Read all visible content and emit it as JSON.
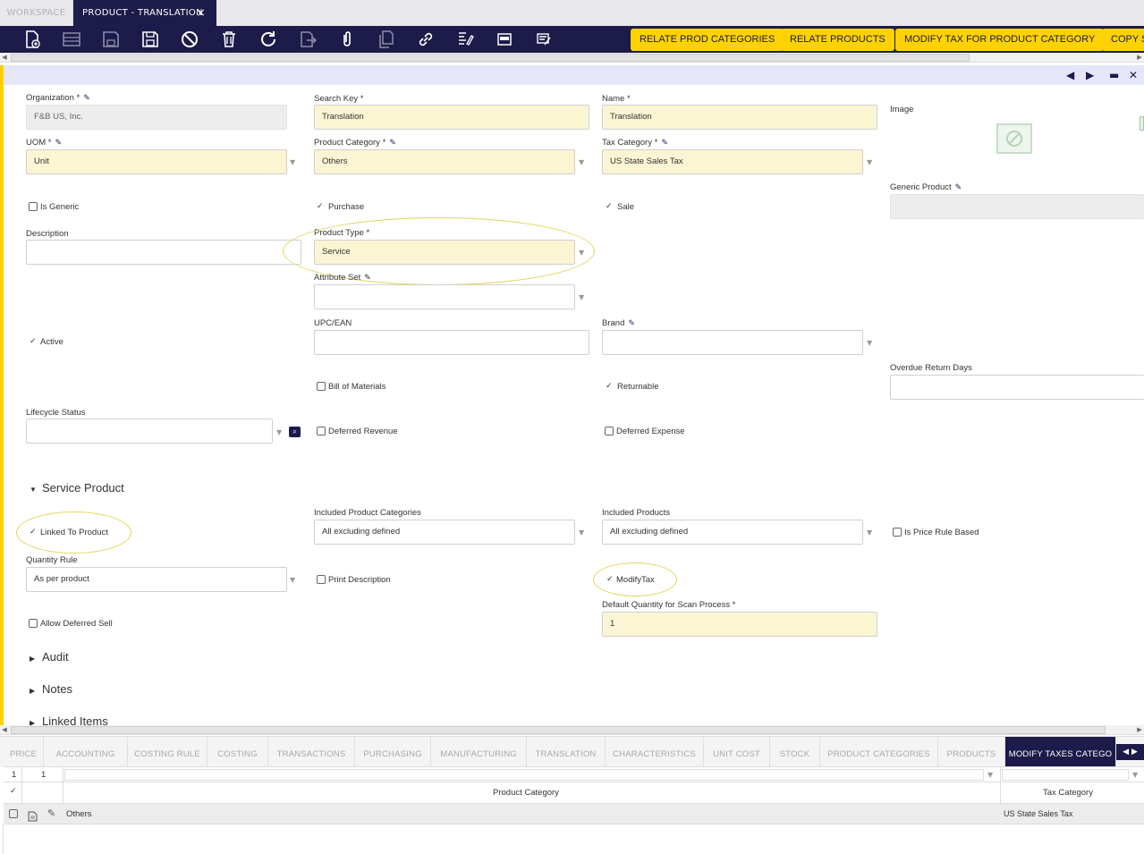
{
  "window_tabs": {
    "workspace": "WORKSPACE",
    "active": "PRODUCT - TRANSLATION",
    "close": "×"
  },
  "toolbar": {
    "icons": [
      "new-document-icon",
      "new-row-icon",
      "save-icon",
      "save-close-icon",
      "undo-icon",
      "delete-icon",
      "refresh-icon",
      "export-icon",
      "attachment-icon",
      "clone-icon",
      "link-icon",
      "print-icon",
      "grid-toggle-icon",
      "audit-icon"
    ],
    "buttons": [
      "RELATE PROD CATEGORIES",
      "RELATE PRODUCTS",
      "MODIFY TAX FOR PRODUCT CATEGORY",
      "COPY S"
    ]
  },
  "form": {
    "organization": {
      "label": "Organization *",
      "value": "F&B US, Inc."
    },
    "search_key": {
      "label": "Search Key *",
      "value": "Translation"
    },
    "name": {
      "label": "Name *",
      "value": "Translation"
    },
    "image": {
      "label": "Image"
    },
    "uom": {
      "label": "UOM *",
      "value": "Unit"
    },
    "product_category": {
      "label": "Product Category *",
      "value": "Others"
    },
    "tax_category": {
      "label": "Tax Category *",
      "value": "US State Sales Tax"
    },
    "generic_product": {
      "label": "Generic Product",
      "value": ""
    },
    "is_generic": {
      "label": "Is Generic",
      "checked": false
    },
    "purchase": {
      "label": "Purchase",
      "checked": true
    },
    "sale": {
      "label": "Sale",
      "checked": true
    },
    "description": {
      "label": "Description",
      "value": ""
    },
    "product_type": {
      "label": "Product Type *",
      "value": "Service"
    },
    "attribute_set": {
      "label": "Attribute Set",
      "value": ""
    },
    "active": {
      "label": "Active",
      "checked": true
    },
    "upc": {
      "label": "UPC/EAN",
      "value": ""
    },
    "brand": {
      "label": "Brand",
      "value": ""
    },
    "overdue_return_days": {
      "label": "Overdue Return Days",
      "value": ""
    },
    "bill_of_materials": {
      "label": "Bill of Materials",
      "checked": false
    },
    "returnable": {
      "label": "Returnable",
      "checked": true
    },
    "lifecycle_status": {
      "label": "Lifecycle Status",
      "value": ""
    },
    "deferred_revenue": {
      "label": "Deferred Revenue",
      "checked": false
    },
    "deferred_expense": {
      "label": "Deferred Expense",
      "checked": false
    }
  },
  "service_section": {
    "title": "Service Product",
    "linked_to_product": {
      "label": "Linked To Product",
      "checked": true
    },
    "included_product_categories": {
      "label": "Included Product Categories",
      "value": "All excluding defined"
    },
    "included_products": {
      "label": "Included Products",
      "value": "All excluding defined"
    },
    "is_price_rule_based": {
      "label": "Is Price Rule Based",
      "checked": false
    },
    "quantity_rule": {
      "label": "Quantity Rule",
      "value": "As per product"
    },
    "print_description": {
      "label": "Print Description",
      "checked": false
    },
    "modify_tax": {
      "label": "ModifyTax",
      "checked": true
    },
    "default_qty_label": "Default Quantity for Scan Process *",
    "default_qty_value": "1",
    "allow_deferred_sell": {
      "label": "Allow Deferred Sell",
      "checked": false
    }
  },
  "sections": [
    "Audit",
    "Notes",
    "Linked Items"
  ],
  "bottom_tabs": [
    "PRICE",
    "ACCOUNTING",
    "COSTING RULE",
    "COSTING",
    "TRANSACTIONS",
    "PURCHASING",
    "MANUFACTURING",
    "TRANSLATION",
    "CHARACTERISTICS",
    "UNIT COST",
    "STOCK",
    "PRODUCT CATEGORIES",
    "PRODUCTS",
    "MODIFY TAXES CATEGO"
  ],
  "grid": {
    "selected_count": "1",
    "total_count": "1",
    "headers": [
      "Product Category",
      "Tax Category"
    ],
    "rows": [
      {
        "product_category": "Others",
        "tax_category": "US State Sales Tax"
      }
    ]
  }
}
